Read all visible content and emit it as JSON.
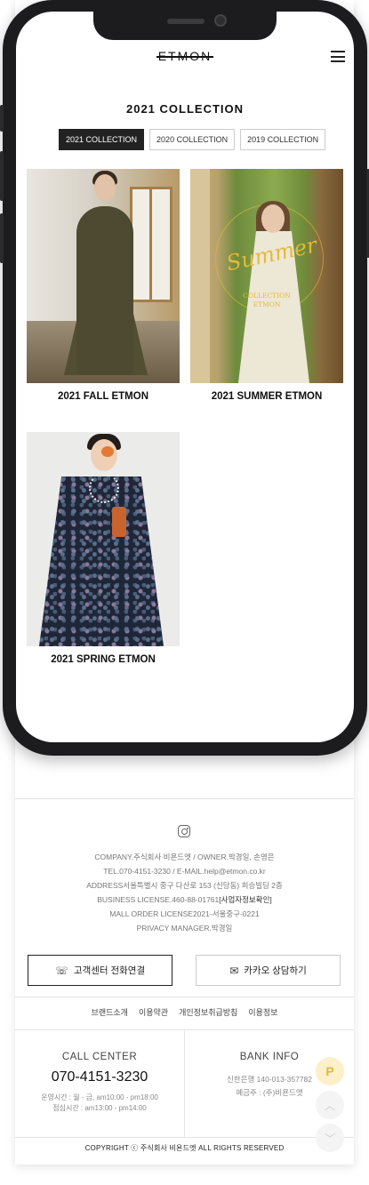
{
  "header": {
    "logo": "ETMON",
    "menu_icon": "hamburger-menu-icon"
  },
  "collection": {
    "title": "2021 COLLECTION",
    "tabs": [
      {
        "label": "2021 COLLECTION",
        "active": true
      },
      {
        "label": "2020 COLLECTION",
        "active": false
      },
      {
        "label": "2019 COLLECTION",
        "active": false
      }
    ],
    "items": [
      {
        "caption": "2021 FALL ETMON"
      },
      {
        "caption": "2021 SUMMER ETMON",
        "overlay_script": "Summer",
        "overlay_sub1": "COLLECTION",
        "overlay_sub2": "ETMON"
      },
      {
        "caption": "2021 SPRING ETMON"
      }
    ]
  },
  "footer": {
    "company": "COMPANY.주식회사 비욘드엣 / OWNER.박경일, 손영은",
    "contact": "TEL.070-4151-3230 / E-MAIL.help@etmon.co.kr",
    "address": "ADDRESS서울특별시 중구 다산로 153 (신당동) 희승빌딩 2층",
    "business": "BUSINESS LICENSE.460-88-01761",
    "business_link": "[사업자정보확인]",
    "mall_order": "MALL ORDER LICENSE2021-서울중구-0221",
    "privacy": "PRIVACY MANAGER.박경일",
    "cta_call": "고객센터 전화연결",
    "cta_kakao": "카카오 상담하기",
    "links": [
      "브랜드소개",
      "이용약관",
      "개인정보취급방침",
      "이용정보"
    ],
    "call_center": {
      "title": "CALL CENTER",
      "number": "070-4151-3230",
      "hours1": "운영시간 : 월 - 금, am10:00 - pm18:00",
      "hours2": "점심시간 : am13:00 - pm14:00"
    },
    "bank_info": {
      "title": "BANK INFO",
      "account": "신한은행 140-013-357782",
      "holder": "예금주 : (주)비욘드엣"
    },
    "copyright": "COPYRIGHT ⓒ 주식회사 비욘드엣 ALL RIGHTS RESERVED"
  },
  "floating": {
    "p_label": "P"
  },
  "colors": {
    "active_tab_bg": "#222222",
    "accent_gold": "#e5b93a",
    "float_p_bg": "#fbf0c9"
  }
}
